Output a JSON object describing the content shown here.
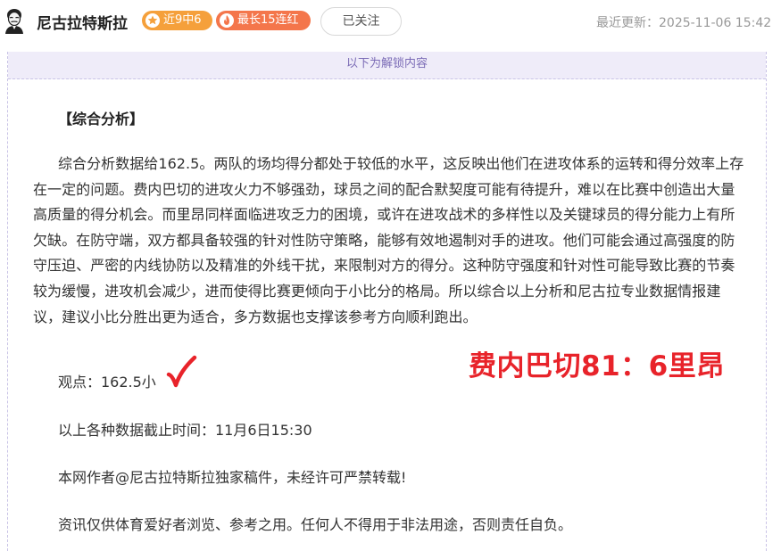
{
  "header": {
    "author_name": "尼古拉特斯拉",
    "avatar_icon": "tesla-portrait-icon",
    "record_badge": "近9中6",
    "record_icon": "star-icon",
    "streak_badge": "最长15连红",
    "streak_icon": "flame-icon",
    "follow_label": "已关注",
    "update_time": "最近更新：2025-11-06 15:42"
  },
  "content": {
    "unlock_banner": "以下为解锁内容",
    "section_title": "【综合分析】",
    "analysis_text": "综合分析数据给162.5。两队的场均得分都处于较低的水平，这反映出他们在进攻体系的运转和得分效率上存在一定的问题。费内巴切的进攻火力不够强劲，球员之间的配合默契度可能有待提升，难以在比赛中创造出大量高质量的得分机会。而里昂同样面临进攻乏力的困境，或许在进攻战术的多样性以及关键球员的得分能力上有所欠缺。在防守端，双方都具备较强的针对性防守策略，能够有效地遏制对手的进攻。他们可能会通过高强度的防守压迫、严密的内线协防以及精准的外线干扰，来限制对方的得分。这种防守强度和针对性可能导致比赛的节奏较为缓慢，进攻机会减少，进而使得比赛更倾向于小比分的格局。所以综合以上分析和尼古拉专业数据情报建议，建议小比分胜出更为适合，多方数据也支撑该参考方向顺利跑出。",
    "verdict": "观点：162.5小",
    "verdict_mark_icon": "red-checkmark-icon",
    "score_stamp": "费内巴切81：6里昂",
    "cutoff": "以上各种数据截止时间：11月6日15:30",
    "copyright": "本网作者@尼古拉特斯拉独家稿件，未经许可严禁转载!",
    "disclaimer": "资讯仅供体育爱好者浏览、参考之用。任何人不得用于非法用途，否则责任自负。"
  },
  "colors": {
    "record_badge": "#f5a03b",
    "streak_badge": "#f4764b",
    "banner_bg": "#efecf9",
    "banner_text": "#7b6bb6",
    "stamp_red": "#e8232a"
  }
}
